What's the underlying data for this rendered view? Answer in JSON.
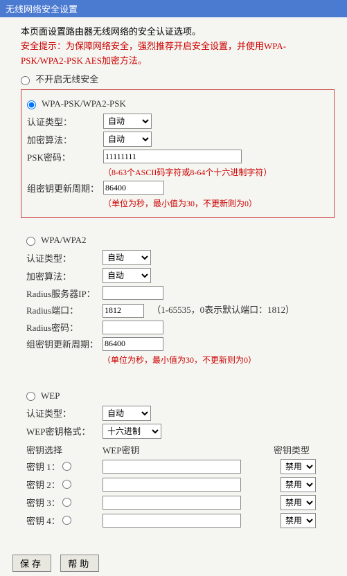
{
  "window_title": "无线网络安全设置",
  "intro": "本页面设置路由器无线网络的安全认证选项。",
  "warn_line1": "安全提示：为保障网络安全，强烈推荐开启安全设置，并使用WPA-",
  "warn_line2": "PSK/WPA2-PSK AES加密方法。",
  "opt_disable": "不开启无线安全",
  "opt_wpapsk": "WPA-PSK/WPA2-PSK",
  "opt_wpa": "WPA/WPA2",
  "opt_wep": "WEP",
  "labels": {
    "auth_type": "认证类型：",
    "enc_algo": "加密算法：",
    "psk": "PSK密码：",
    "group_rekey": "组密钥更新周期：",
    "radius_ip": "Radius服务器IP：",
    "radius_port": "Radius端口：",
    "radius_pw": "Radius密码：",
    "wep_fmt": "WEP密钥格式：",
    "key_select": "密钥选择",
    "wep_key": "WEP密钥",
    "key_type": "密钥类型",
    "key1": "密钥 1：",
    "key2": "密钥 2：",
    "key3": "密钥 3：",
    "key4": "密钥 4："
  },
  "selects": {
    "auto": "自动",
    "hex": "十六进制",
    "disable": "禁用"
  },
  "values": {
    "psk": "11111111",
    "group_rekey": "86400",
    "radius_port": "1812"
  },
  "hints": {
    "psk": "（8-63个ASCII码字符或8-64个十六进制字符）",
    "rekey": "（单位为秒，最小值为30，不更新则为0）",
    "port": "（1-65535，0表示默认端口：1812）"
  },
  "buttons": {
    "save": "保存",
    "help": "帮助"
  }
}
